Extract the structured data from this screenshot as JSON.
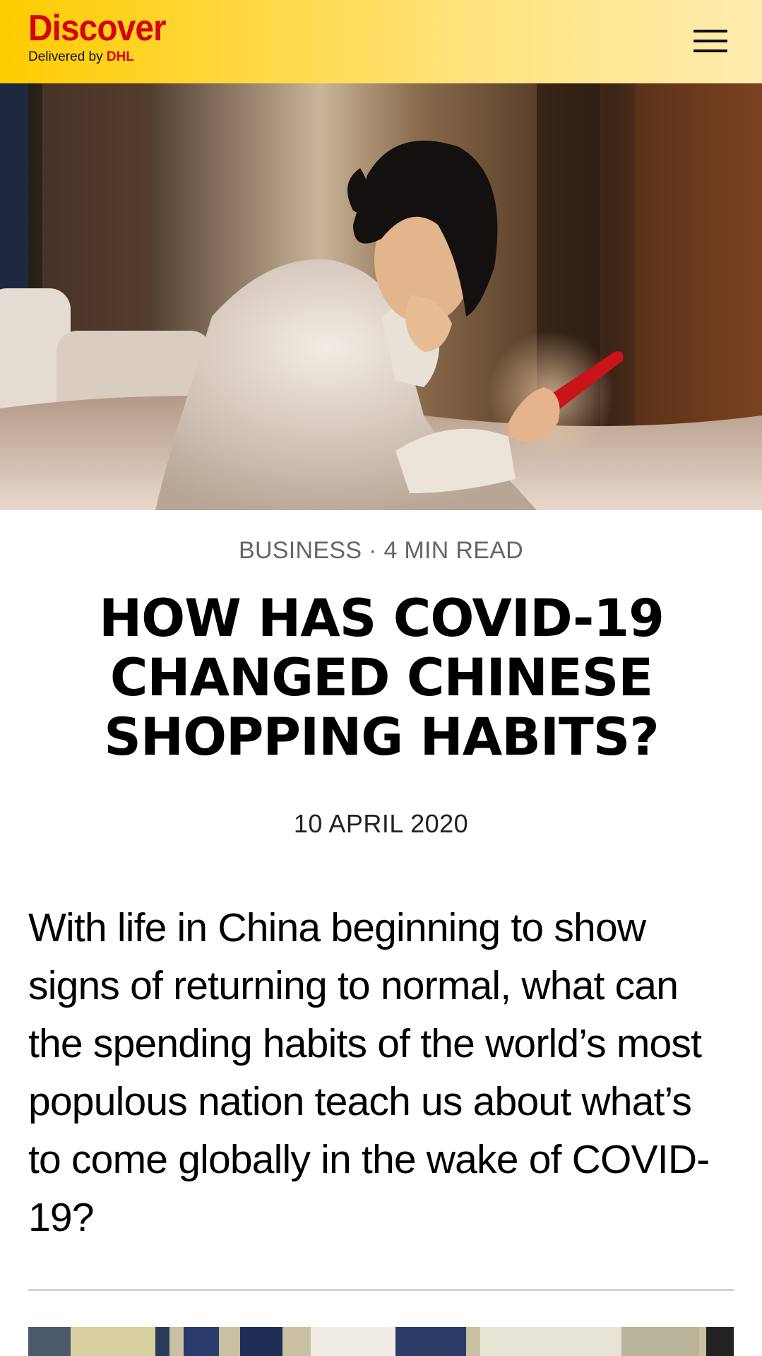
{
  "header": {
    "logo_word": "Discover",
    "logo_sub_prefix": "Delivered by ",
    "logo_brand": "DHL",
    "menu_icon": "hamburger-menu-icon"
  },
  "hero": {
    "image_alt": "Woman lying on bed looking at a red smartphone"
  },
  "article": {
    "category": "BUSINESS",
    "separator": " · ",
    "read_time": "4 MIN READ",
    "title": "HOW HAS COVID-19 CHANGED CHINESE SHOPPING HABITS?",
    "date": "10 APRIL 2020",
    "intro": "With life in China beginning to show signs of returning to normal, what can the spending habits of the world’s most populous nation teach us about what’s to come globally in the wake of COVID-19?"
  },
  "colors": {
    "brand_yellow": "#ffcc00",
    "brand_red": "#d40511",
    "meta_gray": "#666666",
    "divider": "#d3d3d3"
  }
}
